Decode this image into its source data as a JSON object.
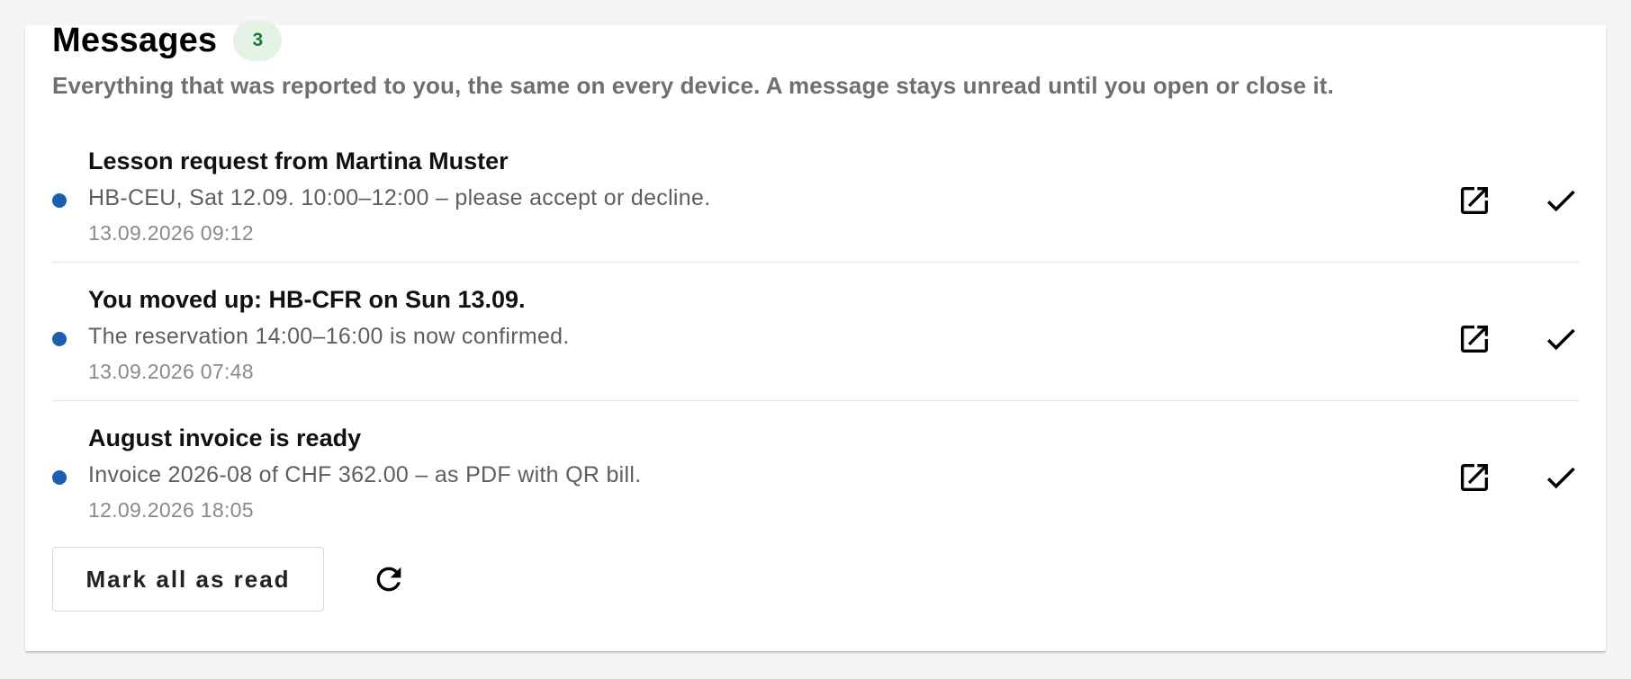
{
  "header": {
    "title": "Messages",
    "unread_count": "3",
    "subtitle": "Everything that was reported to you, the same on every device. A message stays unread until you open or close it."
  },
  "messages": [
    {
      "title": "Lesson request from Martina Muster",
      "body": "HB-CEU, Sat 12.09. 10:00–12:00 – please accept or decline.",
      "time": "13.09.2026 09:12",
      "unread": true
    },
    {
      "title": "You moved up: HB-CFR on Sun 13.09.",
      "body": "The reservation 14:00–16:00 is now confirmed.",
      "time": "13.09.2026 07:48",
      "unread": true
    },
    {
      "title": "August invoice is ready",
      "body": "Invoice 2026-08 of CHF 362.00 – as PDF with QR bill.",
      "time": "12.09.2026 18:05",
      "unread": true
    }
  ],
  "footer": {
    "mark_all_label": "Mark all as read"
  },
  "icons": {
    "open": "open-in-new-icon",
    "check": "check-icon",
    "refresh": "refresh-icon",
    "unread": "unread-dot-icon"
  },
  "colors": {
    "unread_dot": "#1b5fae",
    "badge_bg": "#e4f3e6",
    "badge_text": "#1f7a33"
  }
}
